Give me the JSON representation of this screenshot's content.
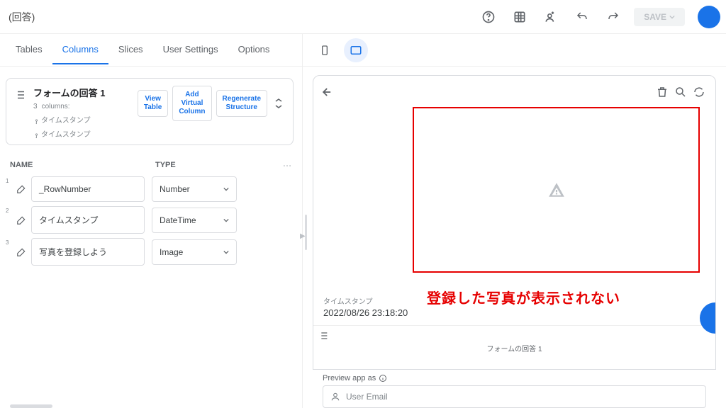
{
  "header": {
    "title": "(回答)",
    "save_label": "SAVE"
  },
  "tabs": {
    "tables": "Tables",
    "columns": "Columns",
    "slices": "Slices",
    "user_settings": "User Settings",
    "options": "Options"
  },
  "card": {
    "title": "フォームの回答 1",
    "sub_prefix": "3",
    "sub_word": "columns:",
    "tag1": "タイムスタンプ",
    "tag2": "タイムスタンプ",
    "btn_view": "View\nTable",
    "btn_add": "Add\nVirtual\nColumn",
    "btn_regen": "Regenerate\nStructure"
  },
  "col_head": {
    "name": "NAME",
    "type": "TYPE"
  },
  "rows": [
    {
      "idx": "1",
      "name": "_RowNumber",
      "type": "Number"
    },
    {
      "idx": "2",
      "name": "タイムスタンプ",
      "type": "DateTime"
    },
    {
      "idx": "3",
      "name": "写真を登録しよう",
      "type": "Image"
    }
  ],
  "annotation": "登録した写真が表示されない",
  "ts": {
    "label": "タイムスタンプ",
    "value": "2022/08/26 23:18:20"
  },
  "bottom_nav": {
    "label": "フォームの回答 1"
  },
  "preview_as": "Preview app as",
  "email_placeholder": "User Email"
}
